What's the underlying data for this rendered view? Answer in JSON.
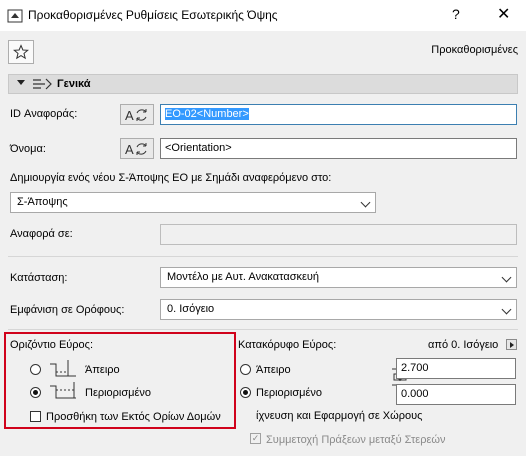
{
  "window": {
    "title": "Προκαθορισμένες Ρυθμίσεις Εσωτερικής Όψης",
    "help_label": "?",
    "close_label": "✕"
  },
  "toolbar": {
    "favorites_label": "Προκαθορισμένες"
  },
  "section": {
    "title": "Γενικά"
  },
  "fields": {
    "ref_id_label": "ID Αναφοράς:",
    "ref_id_value": "EO-02<Number>",
    "name_label": "Όνομα:",
    "name_value": "<Orientation>",
    "create_label": "Δημιουργία ενός νέου Σ-Άποψης ΕΟ με Σημάδι αναφερόμενο στο:",
    "create_value": "Σ-Άποψης",
    "ref_to_label": "Αναφορά σε:",
    "ref_to_value": "",
    "status_label": "Κατάσταση:",
    "status_value": "Μοντέλο με Αυτ. Ανακατασκευή",
    "show_on_floors_label": "Εμφάνιση σε Ορόφους:",
    "show_on_floors_value": "0. Ισόγειο"
  },
  "horizontal_range": {
    "label": "Οριζόντιο Εύρος:",
    "infinite_label": "Άπειρο",
    "limited_label": "Περιορισμένο",
    "selected": "limited",
    "add_outside_label": "Προσθήκη των Εκτός Ορίων Δομών",
    "add_outside_checked": false
  },
  "vertical_range": {
    "label": "Κατακόρυφο Εύρος:",
    "from_label": "από 0. Ισόγειο",
    "infinite_label": "Άπειρο",
    "limited_label": "Περιορισμένο",
    "selected": "limited",
    "top_value": "2.700",
    "bottom_value": "0.000"
  },
  "fill_apply_label": "ίχνευση και Εφαρμογή σε Χώρους",
  "participation": {
    "label": "Συμμετοχή Πράξεων μεταξύ Στερεών",
    "checked": true
  },
  "icons": [
    "app-icon",
    "help-icon",
    "close-icon",
    "star-icon",
    "section-collapse-arrow-icon",
    "section-general-icon",
    "auto-text-icon",
    "chevron-down-icon",
    "horizontal-range-infinite-icon",
    "horizontal-range-limited-icon",
    "vertical-range-icon",
    "arrow-right-icon",
    "checkmark-icon"
  ]
}
